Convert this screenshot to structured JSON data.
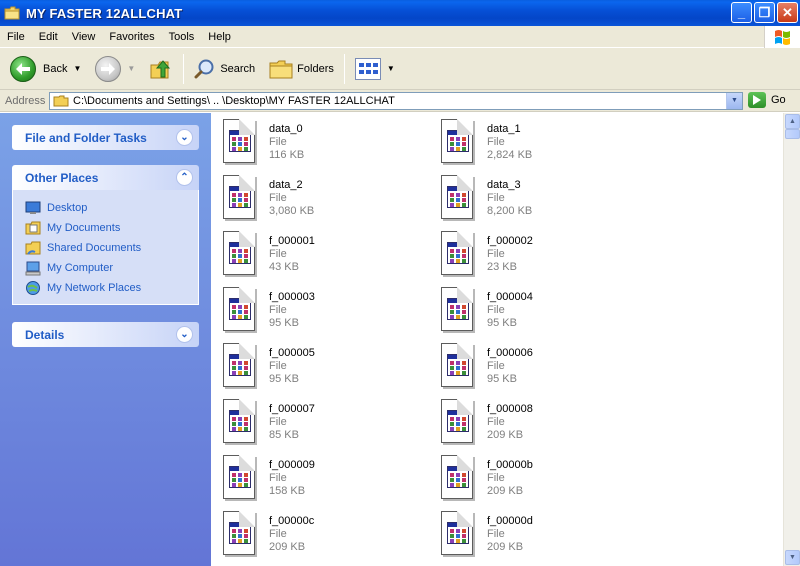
{
  "window": {
    "title": "MY FASTER 12ALLCHAT",
    "buttons": {
      "minimize": "_",
      "maximize": "❐",
      "close": "✕"
    }
  },
  "menu": [
    "File",
    "Edit",
    "View",
    "Favorites",
    "Tools",
    "Help"
  ],
  "toolbar": {
    "back_label": "Back",
    "search_label": "Search",
    "folders_label": "Folders"
  },
  "address": {
    "label": "Address",
    "path": "C:\\Documents and Settings\\ .. \\Desktop\\MY FASTER 12ALLCHAT",
    "go_label": "Go"
  },
  "taskpane": {
    "file_tasks_title": "File and Folder Tasks",
    "other_places_title": "Other Places",
    "details_title": "Details",
    "places": [
      {
        "label": "Desktop",
        "icon": "desktop-icon"
      },
      {
        "label": "My Documents",
        "icon": "my-documents-icon"
      },
      {
        "label": "Shared Documents",
        "icon": "shared-documents-icon"
      },
      {
        "label": "My Computer",
        "icon": "my-computer-icon"
      },
      {
        "label": "My Network Places",
        "icon": "network-places-icon"
      }
    ]
  },
  "files": [
    {
      "name": "data_0",
      "type": "File",
      "size": "116 KB"
    },
    {
      "name": "data_1",
      "type": "File",
      "size": "2,824 KB"
    },
    {
      "name": "data_2",
      "type": "File",
      "size": "3,080 KB"
    },
    {
      "name": "data_3",
      "type": "File",
      "size": "8,200 KB"
    },
    {
      "name": "f_000001",
      "type": "File",
      "size": "43 KB"
    },
    {
      "name": "f_000002",
      "type": "File",
      "size": "23 KB"
    },
    {
      "name": "f_000003",
      "type": "File",
      "size": "95 KB"
    },
    {
      "name": "f_000004",
      "type": "File",
      "size": "95 KB"
    },
    {
      "name": "f_000005",
      "type": "File",
      "size": "95 KB"
    },
    {
      "name": "f_000006",
      "type": "File",
      "size": "95 KB"
    },
    {
      "name": "f_000007",
      "type": "File",
      "size": "85 KB"
    },
    {
      "name": "f_000008",
      "type": "File",
      "size": "209 KB"
    },
    {
      "name": "f_000009",
      "type": "File",
      "size": "158 KB"
    },
    {
      "name": "f_00000b",
      "type": "File",
      "size": "209 KB"
    },
    {
      "name": "f_00000c",
      "type": "File",
      "size": "209 KB"
    },
    {
      "name": "f_00000d",
      "type": "File",
      "size": "209 KB"
    }
  ],
  "colors": {
    "titlebar": "#0446c8",
    "taskpane_top": "#7ba2e7",
    "taskpane_bottom": "#6375d6",
    "link": "#215dc6"
  }
}
